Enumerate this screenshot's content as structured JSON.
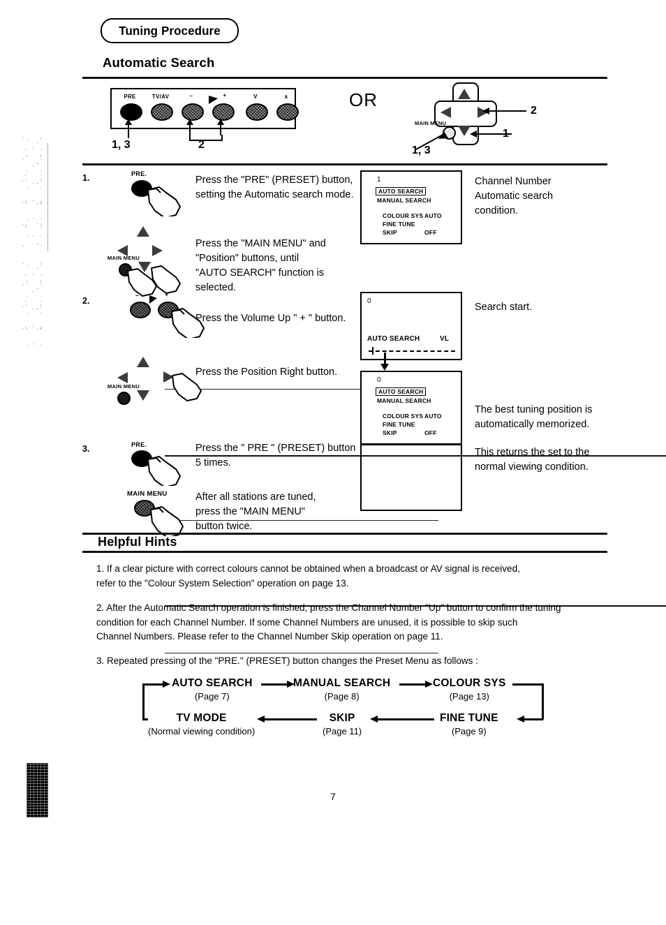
{
  "header": {
    "title": "Tuning Procedure",
    "section": "Automatic Search"
  },
  "top_diagram": {
    "or_label": "OR",
    "tv_panel": {
      "buttons": [
        {
          "cap": "PRE"
        },
        {
          "cap": "TV/AV"
        },
        {
          "cap": "–"
        },
        {
          "cap": "+"
        },
        {
          "cap": "V"
        },
        {
          "cap": "∧"
        }
      ],
      "callout_pre": "1, 3",
      "callout_vol": "2"
    },
    "remote": {
      "main_menu_label": "MAIN MENU",
      "callout_right": "2",
      "callout_down": "1",
      "callout_menu": "1, 3"
    }
  },
  "steps": [
    {
      "num": "1.",
      "icon_cap": "PRE.",
      "text": "Press the \"PRE\" (PRESET) button,\nsetting the Automatic search mode.",
      "osd": {
        "channel": "1",
        "selected": "AUTO SEARCH",
        "item2": "MANUAL SEARCH",
        "rows": [
          {
            "label": "COLOUR SYS",
            "value": "AUTO"
          },
          {
            "label": "FINE TUNE",
            "value": ""
          },
          {
            "label": "SKIP",
            "value": "OFF"
          }
        ]
      },
      "note": "Channel Number\nAutomatic search\ncondition."
    },
    {
      "num": "",
      "icon_cap": "MAIN MENU",
      "text": "Press the \"MAIN MENU\" and\n\"Position\" buttons, until\n\"AUTO SEARCH\" function is selected.",
      "note": ""
    },
    {
      "num": "2.",
      "icon_cap": "",
      "text": "Press the Volume Up \" + \" button.",
      "osd": {
        "channel": "0",
        "label": "AUTO SEARCH",
        "band": "VL"
      },
      "note": "Search start."
    },
    {
      "num": "",
      "icon_cap": "MAIN MENU",
      "text": "Press the Position Right button.",
      "osd": {
        "channel": "0",
        "selected": "AUTO SEARCH",
        "item2": "MANUAL SEARCH",
        "rows": [
          {
            "label": "COLOUR SYS",
            "value": "AUTO"
          },
          {
            "label": "FINE TUNE",
            "value": ""
          },
          {
            "label": "SKIP",
            "value": "OFF"
          }
        ]
      },
      "note": "The best tuning position is\nautomatically memorized."
    },
    {
      "num": "3.",
      "icon_cap": "PRE.",
      "text": "Press the \" PRE \" (PRESET) button\n5 times.",
      "note": "This returns the set to the\nnormal viewing condition."
    },
    {
      "num": "",
      "icon_cap": "MAIN MENU",
      "text": "After all stations are tuned,\npress the \"MAIN MENU\"\nbutton twice.",
      "note": ""
    }
  ],
  "hints": {
    "heading": "Helpful Hints",
    "items": [
      "1. If a clear picture with correct colours cannot be obtained when a broadcast or AV signal is received,\n refer to the \"Colour System Selection\" operation on page 13.",
      "2. After the Automatic Search operation is finished, press the Channel Number \"Up\" button to confirm the tuning\n condition for each Channel Number. If some Channel Numbers are unused, it is possible to skip such\n Channel Numbers. Please refer to the Channel Number Skip operation on page 11.",
      "3. Repeated pressing of the \"PRE.\" (PRESET) button changes the Preset Menu as follows :"
    ]
  },
  "flow": {
    "nodes": [
      {
        "name": "AUTO SEARCH",
        "page": "(Page 7)"
      },
      {
        "name": "MANUAL SEARCH",
        "page": "(Page 8)"
      },
      {
        "name": "COLOUR SYS",
        "page": "(Page 13)"
      },
      {
        "name": "FINE TUNE",
        "page": "(Page 9)"
      },
      {
        "name": "SKIP",
        "page": "(Page 11)"
      },
      {
        "name": "TV MODE",
        "page": "(Normal viewing condition)"
      }
    ]
  },
  "footer": {
    "page_number": "7"
  }
}
